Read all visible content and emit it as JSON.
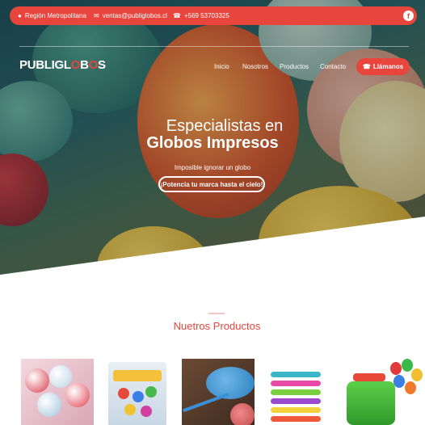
{
  "topbar": {
    "location": "Región Metropolitana",
    "email": "ventas@publiglobos.cl",
    "phone": "+569 53703325",
    "facebook_icon": "f"
  },
  "header": {
    "logo_text_1": "PUBLIGL",
    "logo_o": "O",
    "logo_text_2": "B",
    "logo_o2": "O",
    "logo_text_3": "S",
    "nav": [
      "Inicio",
      "Nosotros",
      "Productos",
      "Contacto"
    ],
    "cta_label": "Llámanos"
  },
  "hero": {
    "title_line1": "Especialistas en",
    "title_line2": "Globos Impresos",
    "subtitle": "Imposible ignorar un globo",
    "button_label": "¡Potencia tu marca hasta el cielo!"
  },
  "products": {
    "title_part1": "Nuetros",
    "title_part2": "Productos"
  },
  "colors": {
    "accent": "#e8453c"
  }
}
